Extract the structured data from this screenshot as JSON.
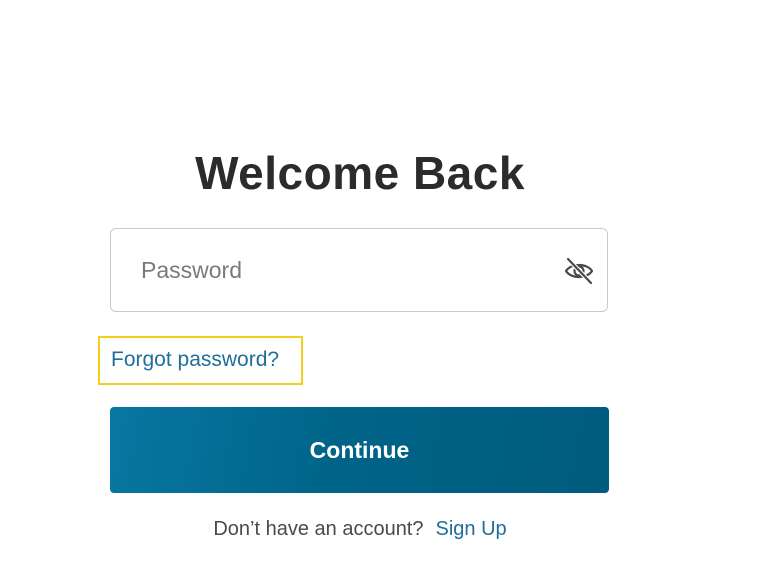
{
  "page": {
    "title": "Welcome Back"
  },
  "password": {
    "placeholder": "Password",
    "value": "",
    "toggle_icon": "eye-slash-icon"
  },
  "forgot": {
    "label": "Forgot password?",
    "highlight_color": "#f3ce1b"
  },
  "continue": {
    "label": "Continue",
    "color": "#006488"
  },
  "signup": {
    "prompt": "Don’t have an account?",
    "link_label": "Sign Up",
    "link_color": "#1f6f9a"
  }
}
